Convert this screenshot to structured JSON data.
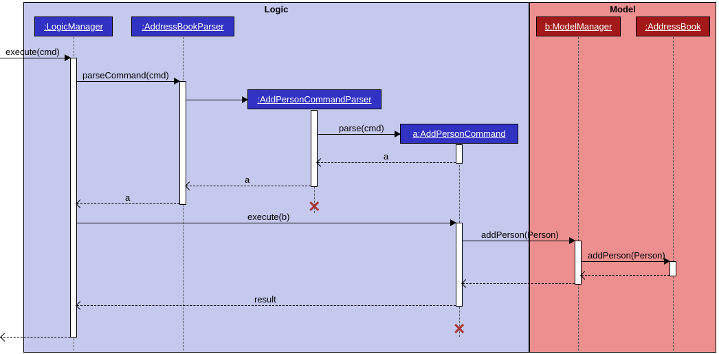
{
  "frames": {
    "logic": {
      "label": "Logic"
    },
    "model": {
      "label": "Model"
    }
  },
  "lifelines": {
    "logicManager": ":LogicManager",
    "addressBookParser": ":AddressBookParser",
    "addPersonCommandParser": ":AddPersonCommandParser",
    "addPersonCommand": "a:AddPersonCommand",
    "modelManager": "b:ModelManager",
    "addressBook": ":AddressBook"
  },
  "messages": {
    "m1": "execute(cmd)",
    "m2": "parseCommand(cmd)",
    "m3": "parse(cmd)",
    "r3": "a",
    "r2": "a",
    "r1": "a",
    "m4": "execute(b)",
    "m5": "addPerson(Person)",
    "m6": "addPerson(Person)",
    "r4": "result"
  },
  "chart_data": {
    "type": "sequence-diagram",
    "frames": [
      {
        "name": "Logic",
        "contains": [
          ":LogicManager",
          ":AddressBookParser",
          ":AddPersonCommandParser",
          "a:AddPersonCommand"
        ]
      },
      {
        "name": "Model",
        "contains": [
          "b:ModelManager",
          ":AddressBook"
        ]
      }
    ],
    "lifelines": [
      {
        "id": "LM",
        "name": ":LogicManager",
        "created": "preexisting"
      },
      {
        "id": "ABP",
        "name": ":AddressBookParser",
        "created": "preexisting"
      },
      {
        "id": "APCP",
        "name": ":AddPersonCommandParser",
        "created": "by-message",
        "destroyed": true
      },
      {
        "id": "APC",
        "name": "a:AddPersonCommand",
        "created": "by-message",
        "destroyed": true
      },
      {
        "id": "MM",
        "name": "b:ModelManager",
        "created": "preexisting"
      },
      {
        "id": "AB",
        "name": ":AddressBook",
        "created": "preexisting"
      }
    ],
    "messages": [
      {
        "from": "external",
        "to": "LM",
        "label": "execute(cmd)",
        "type": "sync"
      },
      {
        "from": "LM",
        "to": "ABP",
        "label": "parseCommand(cmd)",
        "type": "sync"
      },
      {
        "from": "ABP",
        "to": "APCP",
        "label": "",
        "type": "create"
      },
      {
        "from": "APCP",
        "to": "APC",
        "label": "parse(cmd)",
        "type": "create"
      },
      {
        "from": "APC",
        "to": "APCP",
        "label": "a",
        "type": "return"
      },
      {
        "from": "APCP",
        "to": "ABP",
        "label": "a",
        "type": "return"
      },
      {
        "from": "ABP",
        "to": "LM",
        "label": "a",
        "type": "return"
      },
      {
        "from": "LM",
        "to": "APC",
        "label": "execute(b)",
        "type": "sync"
      },
      {
        "from": "APC",
        "to": "MM",
        "label": "addPerson(Person)",
        "type": "sync"
      },
      {
        "from": "MM",
        "to": "AB",
        "label": "addPerson(Person)",
        "type": "sync"
      },
      {
        "from": "AB",
        "to": "MM",
        "label": "",
        "type": "return"
      },
      {
        "from": "MM",
        "to": "APC",
        "label": "",
        "type": "return"
      },
      {
        "from": "APC",
        "to": "LM",
        "label": "result",
        "type": "return"
      },
      {
        "from": "LM",
        "to": "external",
        "label": "",
        "type": "return"
      }
    ]
  }
}
